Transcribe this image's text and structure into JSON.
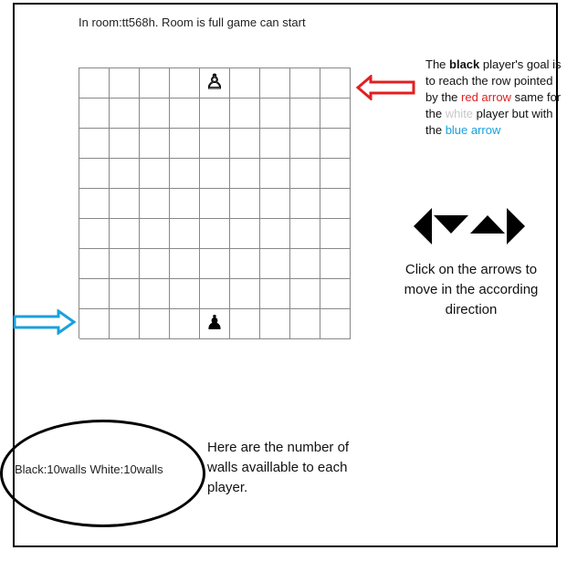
{
  "status": "In room:tt568h. Room is full game can start",
  "board": {
    "size": 9,
    "white_pawn": {
      "row": 0,
      "col": 4,
      "glyph": "♙"
    },
    "black_pawn": {
      "row": 8,
      "col": 4,
      "glyph": "♟"
    }
  },
  "goal_note": {
    "p1": "The ",
    "black_word": "black",
    "p2": " player's goal is to reach the row pointed by the ",
    "red_arrow_text": "red arrow",
    "p3": " same for the ",
    "white_word": "white",
    "p4": " player but with the ",
    "blue_arrow_text": "blue arrow"
  },
  "controls_help": "Click on the arrows to move in the according direction",
  "walls_status": {
    "black": "Black:10walls",
    "white": "White:10walls"
  },
  "walls_help": "Here are the number of walls availlable to each player.",
  "colors": {
    "red_arrow": "#e02020",
    "blue_arrow": "#1aa0dd",
    "white_text": "#c8c8c8"
  }
}
